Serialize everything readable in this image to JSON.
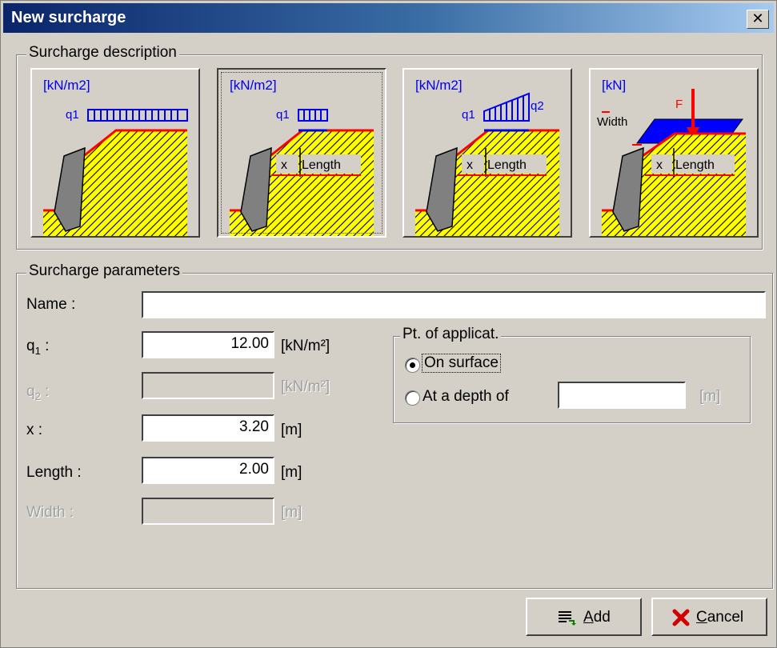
{
  "window": {
    "title": "New surcharge",
    "close_glyph": "✕"
  },
  "description_group": {
    "label": "Surcharge description",
    "types": [
      {
        "unit": "[kN/m2]",
        "q1": "q1"
      },
      {
        "unit": "[kN/m2]",
        "q1": "q1",
        "x": "x",
        "length": "Length"
      },
      {
        "unit": "[kN/m2]",
        "q1": "q1",
        "q2": "q2",
        "x": "x",
        "length": "Length"
      },
      {
        "unit": "[kN]",
        "f": "F",
        "width": "Width",
        "x": "x",
        "length": "Length"
      }
    ]
  },
  "parameters_group": {
    "label": "Surcharge parameters",
    "name": {
      "label": "Name :",
      "value": ""
    },
    "q1": {
      "label_main": "q",
      "label_sub": "1",
      "label_tail": " :",
      "value": "12.00",
      "unit": "[kN/m²]"
    },
    "q2": {
      "label_main": "q",
      "label_sub": "2",
      "label_tail": " :",
      "value": "",
      "unit": "[kN/m²]",
      "disabled": true
    },
    "x": {
      "label": "x :",
      "value": "3.20",
      "unit": "[m]"
    },
    "length": {
      "label": "Length :",
      "value": "2.00",
      "unit": "[m]"
    },
    "width": {
      "label": "Width :",
      "value": "",
      "unit": "[m]",
      "disabled": true
    },
    "application": {
      "label": "Pt. of applicat.",
      "on_surface": {
        "label": "On surface",
        "selected": true
      },
      "at_depth": {
        "label": "At a depth of",
        "value": "",
        "unit": "[m]",
        "selected": false
      }
    }
  },
  "buttons": {
    "add": {
      "underline": "A",
      "rest": "dd",
      "icon": "add-list-icon"
    },
    "cancel": {
      "underline": "C",
      "rest": "ancel",
      "icon": "red-x-icon"
    }
  },
  "colors": {
    "title_start": "#0a246a",
    "title_end": "#a6caf0",
    "face": "#d4d0c8",
    "hatch": "#ffff00",
    "load": "#0000ee",
    "surface_line": "#ff0000"
  }
}
